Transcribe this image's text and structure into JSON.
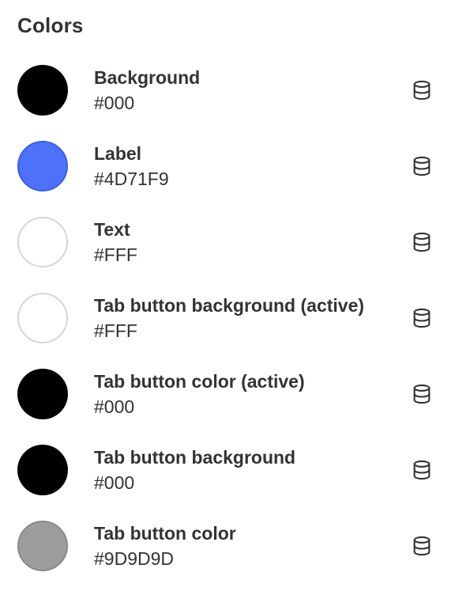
{
  "section": {
    "title": "Colors"
  },
  "colors": [
    {
      "label": "Background",
      "value": "#000",
      "swatch": "#000000",
      "icon": "database-icon"
    },
    {
      "label": "Label",
      "value": "#4D71F9",
      "swatch": "#4D71F9",
      "icon": "database-icon"
    },
    {
      "label": "Text",
      "value": "#FFF",
      "swatch": "#FFFFFF",
      "icon": "database-icon"
    },
    {
      "label": "Tab button background (active)",
      "value": "#FFF",
      "swatch": "#FFFFFF",
      "icon": "database-icon"
    },
    {
      "label": "Tab button color (active)",
      "value": "#000",
      "swatch": "#000000",
      "icon": "database-icon"
    },
    {
      "label": "Tab button background",
      "value": "#000",
      "swatch": "#000000",
      "icon": "database-icon"
    },
    {
      "label": "Tab button color",
      "value": "#9D9D9D",
      "swatch": "#9D9D9D",
      "icon": "database-icon"
    }
  ]
}
